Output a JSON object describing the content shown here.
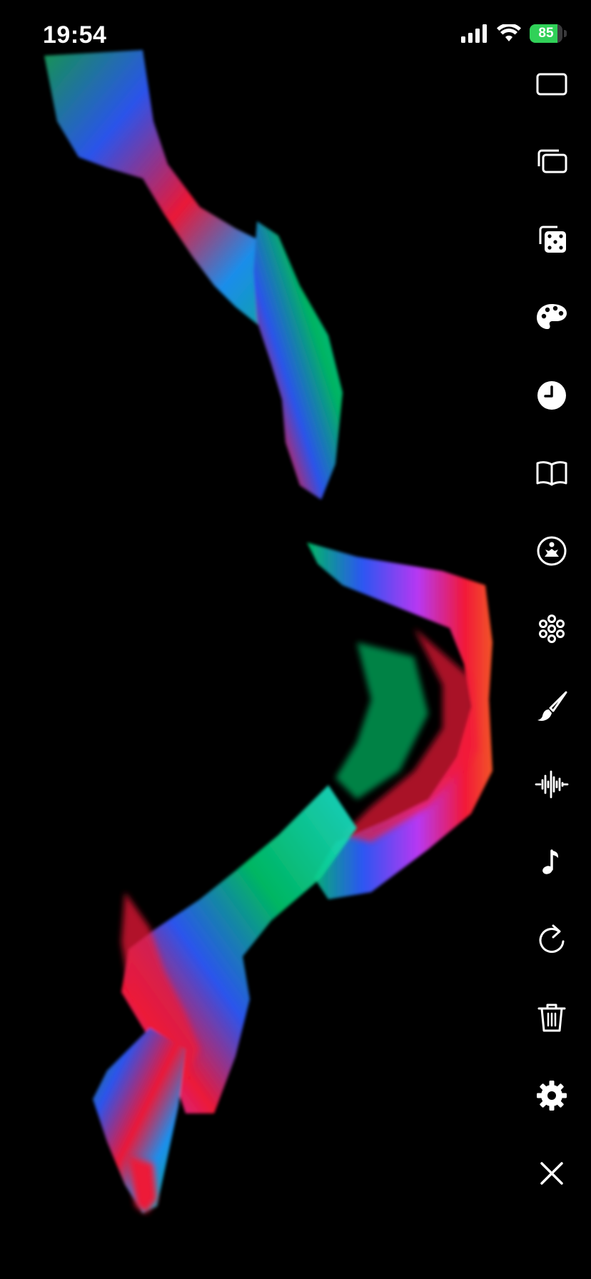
{
  "status_bar": {
    "time": "19:54",
    "battery_level": "85",
    "battery_fraction": 0.85,
    "battery_color": "#30d158",
    "charging": true
  },
  "toolbar": {
    "items": [
      {
        "name": "single-frame",
        "icon": "rectangle-icon"
      },
      {
        "name": "multi-frame",
        "icon": "stacked-rectangles-icon"
      },
      {
        "name": "randomize",
        "icon": "dice-icon"
      },
      {
        "name": "palette",
        "icon": "palette-icon"
      },
      {
        "name": "speed",
        "icon": "clock-icon"
      },
      {
        "name": "library",
        "icon": "book-icon"
      },
      {
        "name": "meditate",
        "icon": "meditation-icon"
      },
      {
        "name": "pattern",
        "icon": "flower-icon"
      },
      {
        "name": "brush",
        "icon": "paintbrush-icon"
      },
      {
        "name": "audio-reactive",
        "icon": "waveform-icon"
      },
      {
        "name": "music",
        "icon": "music-note-icon"
      },
      {
        "name": "reset",
        "icon": "refresh-icon"
      },
      {
        "name": "clear",
        "icon": "trash-icon"
      },
      {
        "name": "settings",
        "icon": "gear-icon"
      },
      {
        "name": "close",
        "icon": "close-icon"
      }
    ]
  },
  "colors": {
    "background": "#000000",
    "icon": "#ffffff",
    "stroke_palette": [
      "#ff1a3c",
      "#ff5a2a",
      "#2f5bff",
      "#1e9aff",
      "#00c46a",
      "#c23bff",
      "#1fe0d0"
    ]
  }
}
